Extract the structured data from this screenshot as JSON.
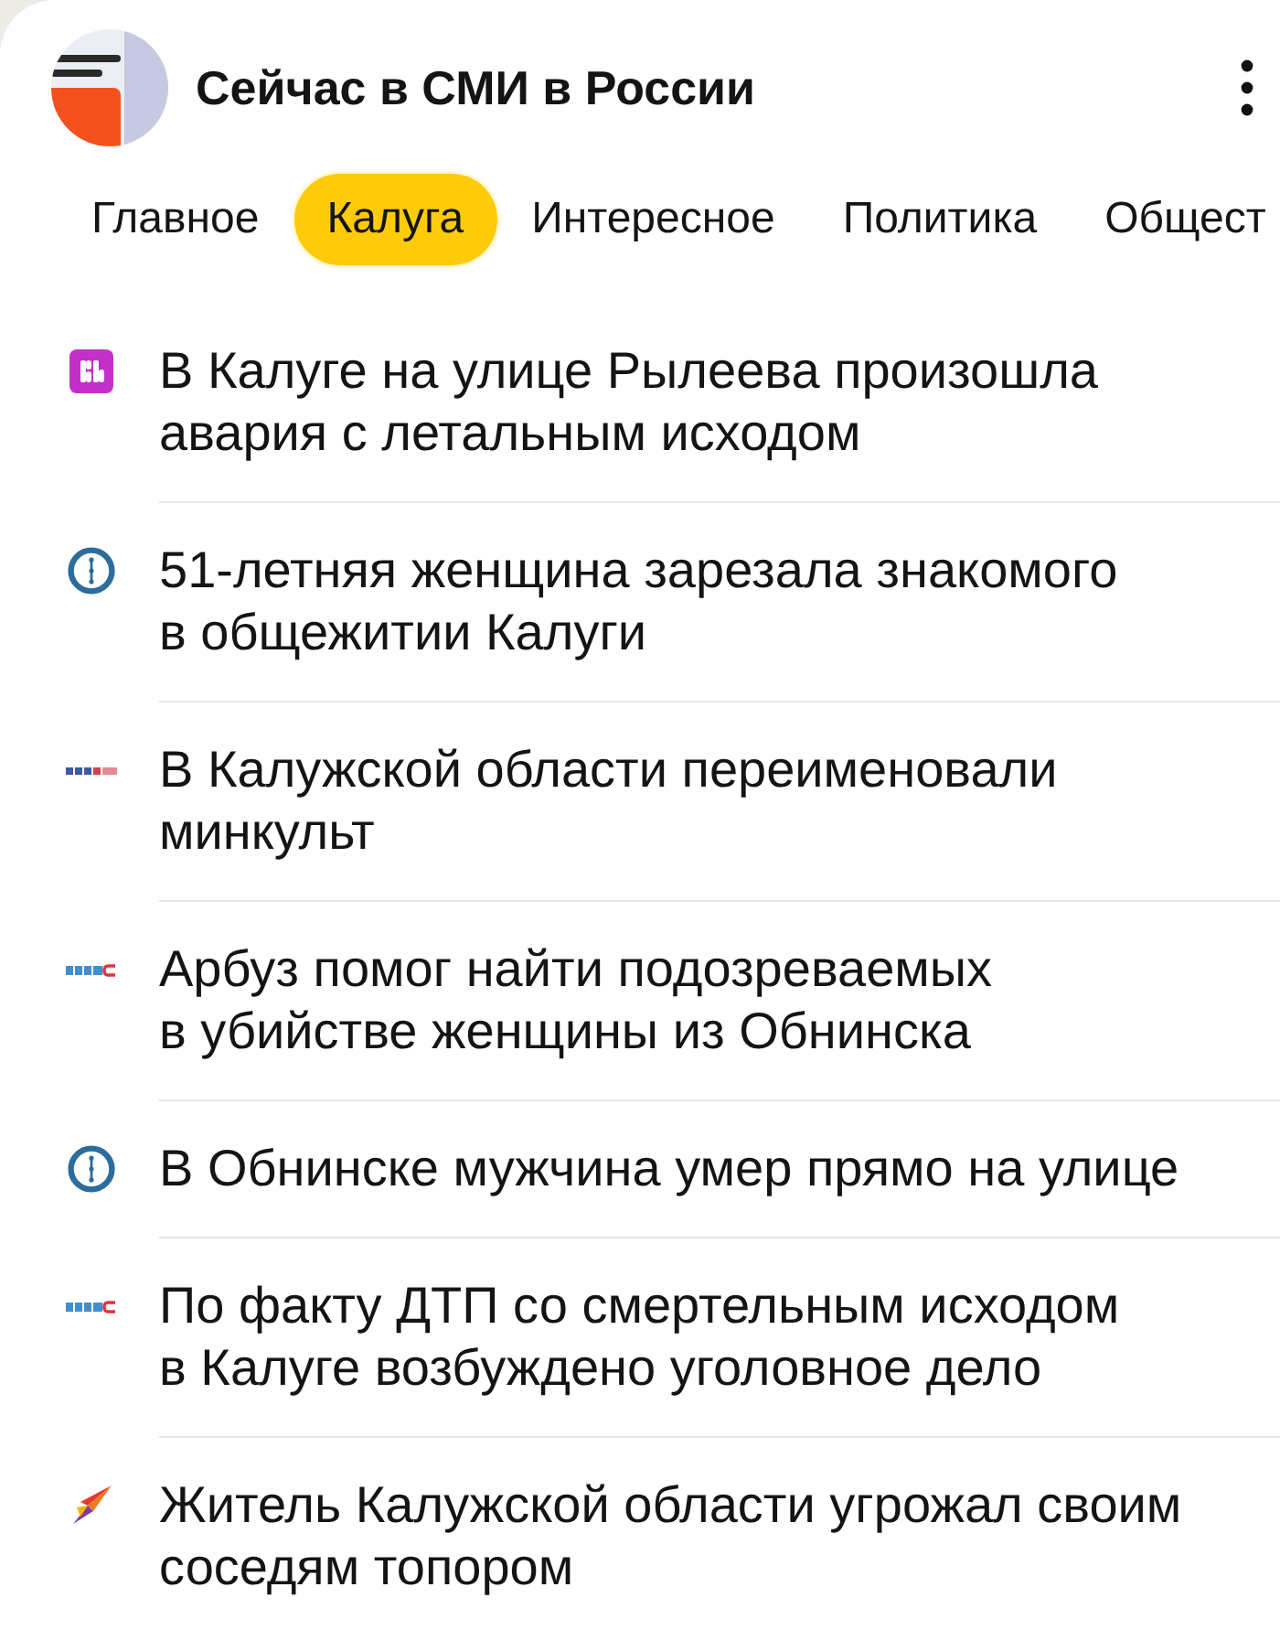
{
  "header": {
    "title": "Сейчас в СМИ в России"
  },
  "tabs": [
    {
      "label": "Главное",
      "selected": false
    },
    {
      "label": "Калуга",
      "selected": true
    },
    {
      "label": "Интересное",
      "selected": false
    },
    {
      "label": "Политика",
      "selected": false
    },
    {
      "label": "Общест",
      "selected": false
    }
  ],
  "news": [
    {
      "kind": "tile",
      "title": "В Калуге на улице Рылеева произошла авария с летальным исходом"
    },
    {
      "kind": "ring",
      "title": "51-летняя женщина зарезала знакомого в общежитии Калуги"
    },
    {
      "kind": "wordmark",
      "title": "В Калужской области переименовали минкульт"
    },
    {
      "kind": "wordmark-accent",
      "title": "Арбуз помог найти подозреваемых в убийстве женщины из Обнинска"
    },
    {
      "kind": "ring",
      "title": "В Обнинске мужчина умер прямо на улице"
    },
    {
      "kind": "wordmark-accent",
      "title": "По факту ДТП со смертельным исходом в Калуге возбуждено уголовное дело"
    },
    {
      "kind": "bird",
      "title": "Житель Калужской области угрожал своим соседям топором"
    }
  ]
}
